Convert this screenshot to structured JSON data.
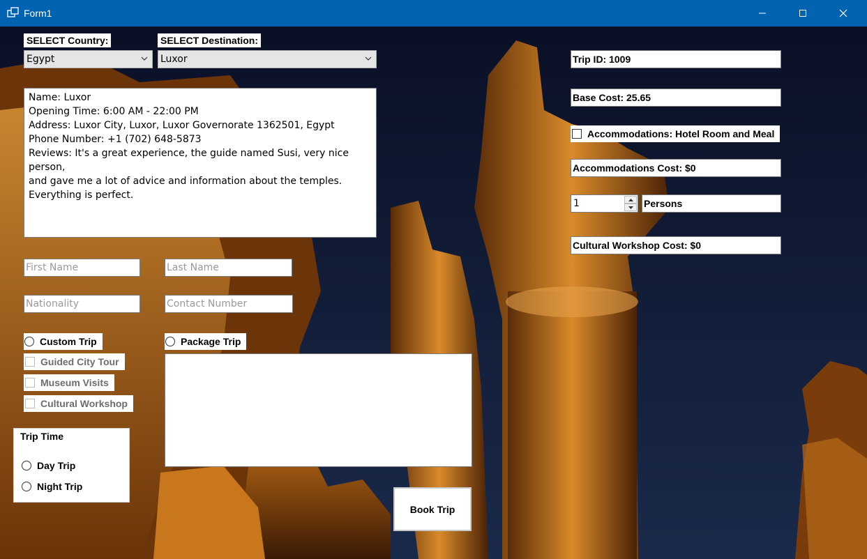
{
  "window": {
    "title": "Form1"
  },
  "labels": {
    "select_country": "SELECT Country:",
    "select_destination": "SELECT Destination:"
  },
  "combos": {
    "country": "Egypt",
    "destination": "Luxor"
  },
  "details": {
    "lines": [
      "Name: Luxor",
      "Opening Time: 6:00 AM - 22:00 PM",
      "Address: Luxor City, Luxor, Luxor Governorate 1362501, Egypt",
      "Phone Number: +1 (702) 648-5873",
      "Reviews: It's a great experience, the guide named Susi, very nice person,",
      "and gave me a lot of advice and information about the temples.",
      "Everything is perfect."
    ]
  },
  "inputs": {
    "first_name_placeholder": "First Name",
    "last_name_placeholder": "Last Name",
    "nationality_placeholder": "Nationality",
    "contact_placeholder": "Contact Number"
  },
  "options": {
    "custom_trip": "Custom Trip",
    "package_trip": "Package Trip",
    "guided_city_tour": "Guided City Tour",
    "museum_visits": "Museum Visits",
    "cultural_workshop": "Cultural Workshop"
  },
  "trip_time": {
    "title": "Trip Time",
    "day": "Day Trip",
    "night": "Night Trip"
  },
  "right_panel": {
    "trip_id": "Trip ID: 1009",
    "base_cost": "Base Cost: 25.65",
    "accommodations_check": "Accommodations: Hotel Room and Meal",
    "accommodations_cost": "Accommodations Cost: $0",
    "persons_value": "1",
    "persons_label": "Persons",
    "workshop_cost": "Cultural Workshop Cost: $0"
  },
  "book_button": "Book Trip",
  "colors": {
    "titlebar": "#0063b1",
    "sky": "#101a33",
    "stone_glow": "#c8741a"
  }
}
